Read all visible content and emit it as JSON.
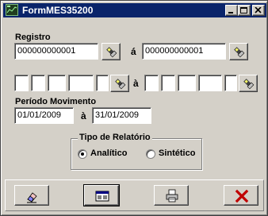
{
  "window": {
    "title": "FormMES35200"
  },
  "registro": {
    "label": "Registro",
    "from_value": "000000000001",
    "separator": "á",
    "to_value": "000000000001"
  },
  "range2": {
    "separator": "à"
  },
  "periodo": {
    "label": "Período Movimento",
    "from_value": "01/01/2009",
    "separator": "à",
    "to_value": "31/01/2009"
  },
  "tipo_relatorio": {
    "label": "Tipo de Relatório",
    "options": [
      {
        "label": "Analítico",
        "selected": true
      },
      {
        "label": "Sintético",
        "selected": false
      }
    ]
  },
  "icons": {
    "app": "app-logo-icon",
    "lookup": "flashlight-icon",
    "clear": "eraser-icon",
    "preview": "preview-icon",
    "print": "printer-icon",
    "close": "x-icon"
  },
  "colors": {
    "title_bar": "#0a246a",
    "close_x": "#c00000",
    "face": "#d4d0c8"
  }
}
